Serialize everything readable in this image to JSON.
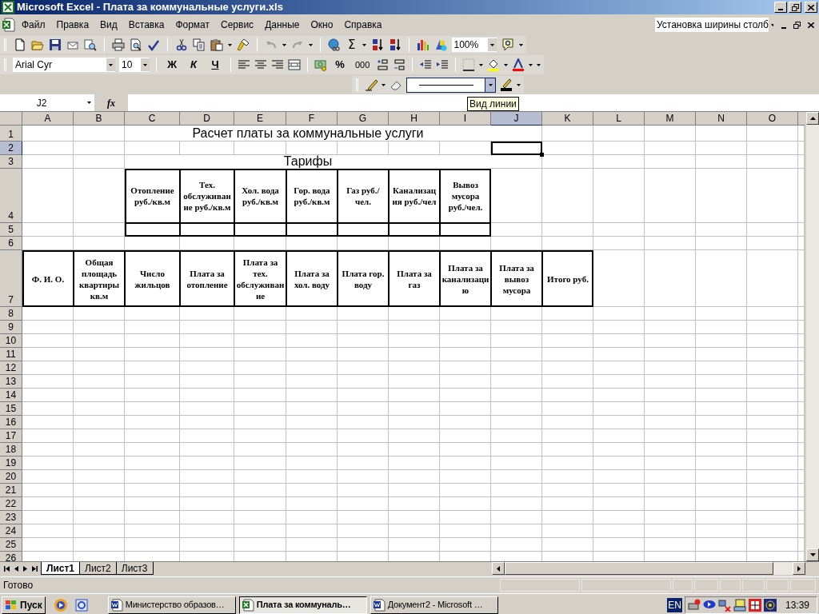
{
  "window": {
    "title": "Microsoft Excel - Плата за коммунальные услуги.xls"
  },
  "menu": [
    "Файл",
    "Правка",
    "Вид",
    "Вставка",
    "Формат",
    "Сервис",
    "Данные",
    "Окно",
    "Справка"
  ],
  "help_search": {
    "value": "Установка ширины столб"
  },
  "toolbar": {
    "autosum": "Σ",
    "zoom": "100%"
  },
  "formatting": {
    "font": "Arial Cyr",
    "size": "10",
    "bold": "Ж",
    "italic": "К",
    "underline": "Ч",
    "percent": "%",
    "thousands": "000"
  },
  "tooltip": "Вид линии",
  "formula_bar": {
    "name_box": "J2",
    "fx": "fx"
  },
  "sheet": {
    "columns": [
      {
        "label": "A",
        "selected": false
      },
      {
        "label": "B",
        "selected": false
      },
      {
        "label": "C",
        "selected": false
      },
      {
        "label": "D",
        "selected": false
      },
      {
        "label": "E",
        "selected": false
      },
      {
        "label": "F",
        "selected": false
      },
      {
        "label": "G",
        "selected": false
      },
      {
        "label": "H",
        "selected": false
      },
      {
        "label": "I",
        "selected": false
      },
      {
        "label": "J",
        "selected": true
      },
      {
        "label": "K",
        "selected": false
      },
      {
        "label": "L",
        "selected": false
      },
      {
        "label": "M",
        "selected": false
      },
      {
        "label": "N",
        "selected": false
      },
      {
        "label": "O",
        "selected": false
      }
    ],
    "rows": [
      {
        "label": "1",
        "selected": false
      },
      {
        "label": "2",
        "selected": true
      },
      {
        "label": "3",
        "selected": false
      },
      {
        "label": "4",
        "selected": false
      },
      {
        "label": "5",
        "selected": false
      },
      {
        "label": "6",
        "selected": false
      },
      {
        "label": "7",
        "selected": false
      },
      {
        "label": "8",
        "selected": false
      },
      {
        "label": "9",
        "selected": false
      },
      {
        "label": "10",
        "selected": false
      },
      {
        "label": "11",
        "selected": false
      },
      {
        "label": "12",
        "selected": false
      },
      {
        "label": "13",
        "selected": false
      },
      {
        "label": "14",
        "selected": false
      },
      {
        "label": "15",
        "selected": false
      },
      {
        "label": "16",
        "selected": false
      },
      {
        "label": "17",
        "selected": false
      },
      {
        "label": "18",
        "selected": false
      },
      {
        "label": "19",
        "selected": false
      },
      {
        "label": "20",
        "selected": false
      },
      {
        "label": "21",
        "selected": false
      },
      {
        "label": "22",
        "selected": false
      },
      {
        "label": "23",
        "selected": false
      },
      {
        "label": "24",
        "selected": false
      },
      {
        "label": "25",
        "selected": false
      },
      {
        "label": "26",
        "selected": false
      }
    ],
    "title": "Расчет платы за коммунальные услуги",
    "tariffs": {
      "heading": "Тарифы",
      "columns": [
        "Отопление руб./кв.м",
        "Тех. обслуживание руб./кв.м",
        "Хол. вода руб./кв.м",
        "Гор. вода руб./кв.м",
        "Газ руб./чел.",
        "Канализация руб./чел",
        "Вывоз мусора руб./чел."
      ]
    },
    "payments": {
      "columns": [
        "Ф. И. О.",
        "Общая площадь квартиры кв.м",
        "Число жильцов",
        "Плата за отопление",
        "Плата за тех. обслуживание",
        "Плата за хол. воду",
        "Плата гор. воду",
        "Плата за газ",
        "Плата за канализацию",
        "Плата за вывоз мусора",
        "Итого руб."
      ]
    }
  },
  "sheet_tabs": [
    {
      "label": "Лист1",
      "selected": true
    },
    {
      "label": "Лист2",
      "selected": false
    },
    {
      "label": "Лист3",
      "selected": false
    }
  ],
  "status_bar": {
    "text": "Готово"
  },
  "taskbar": {
    "start": "Пуск",
    "tasks": [
      {
        "label": "Министерство образов…",
        "kind": "word",
        "selected": false
      },
      {
        "label": "Плата за коммуналь…",
        "kind": "excel",
        "selected": true
      },
      {
        "label": "Документ2 - Microsoft …",
        "kind": "word",
        "selected": false
      }
    ],
    "language": "EN",
    "clock": "13:39"
  }
}
